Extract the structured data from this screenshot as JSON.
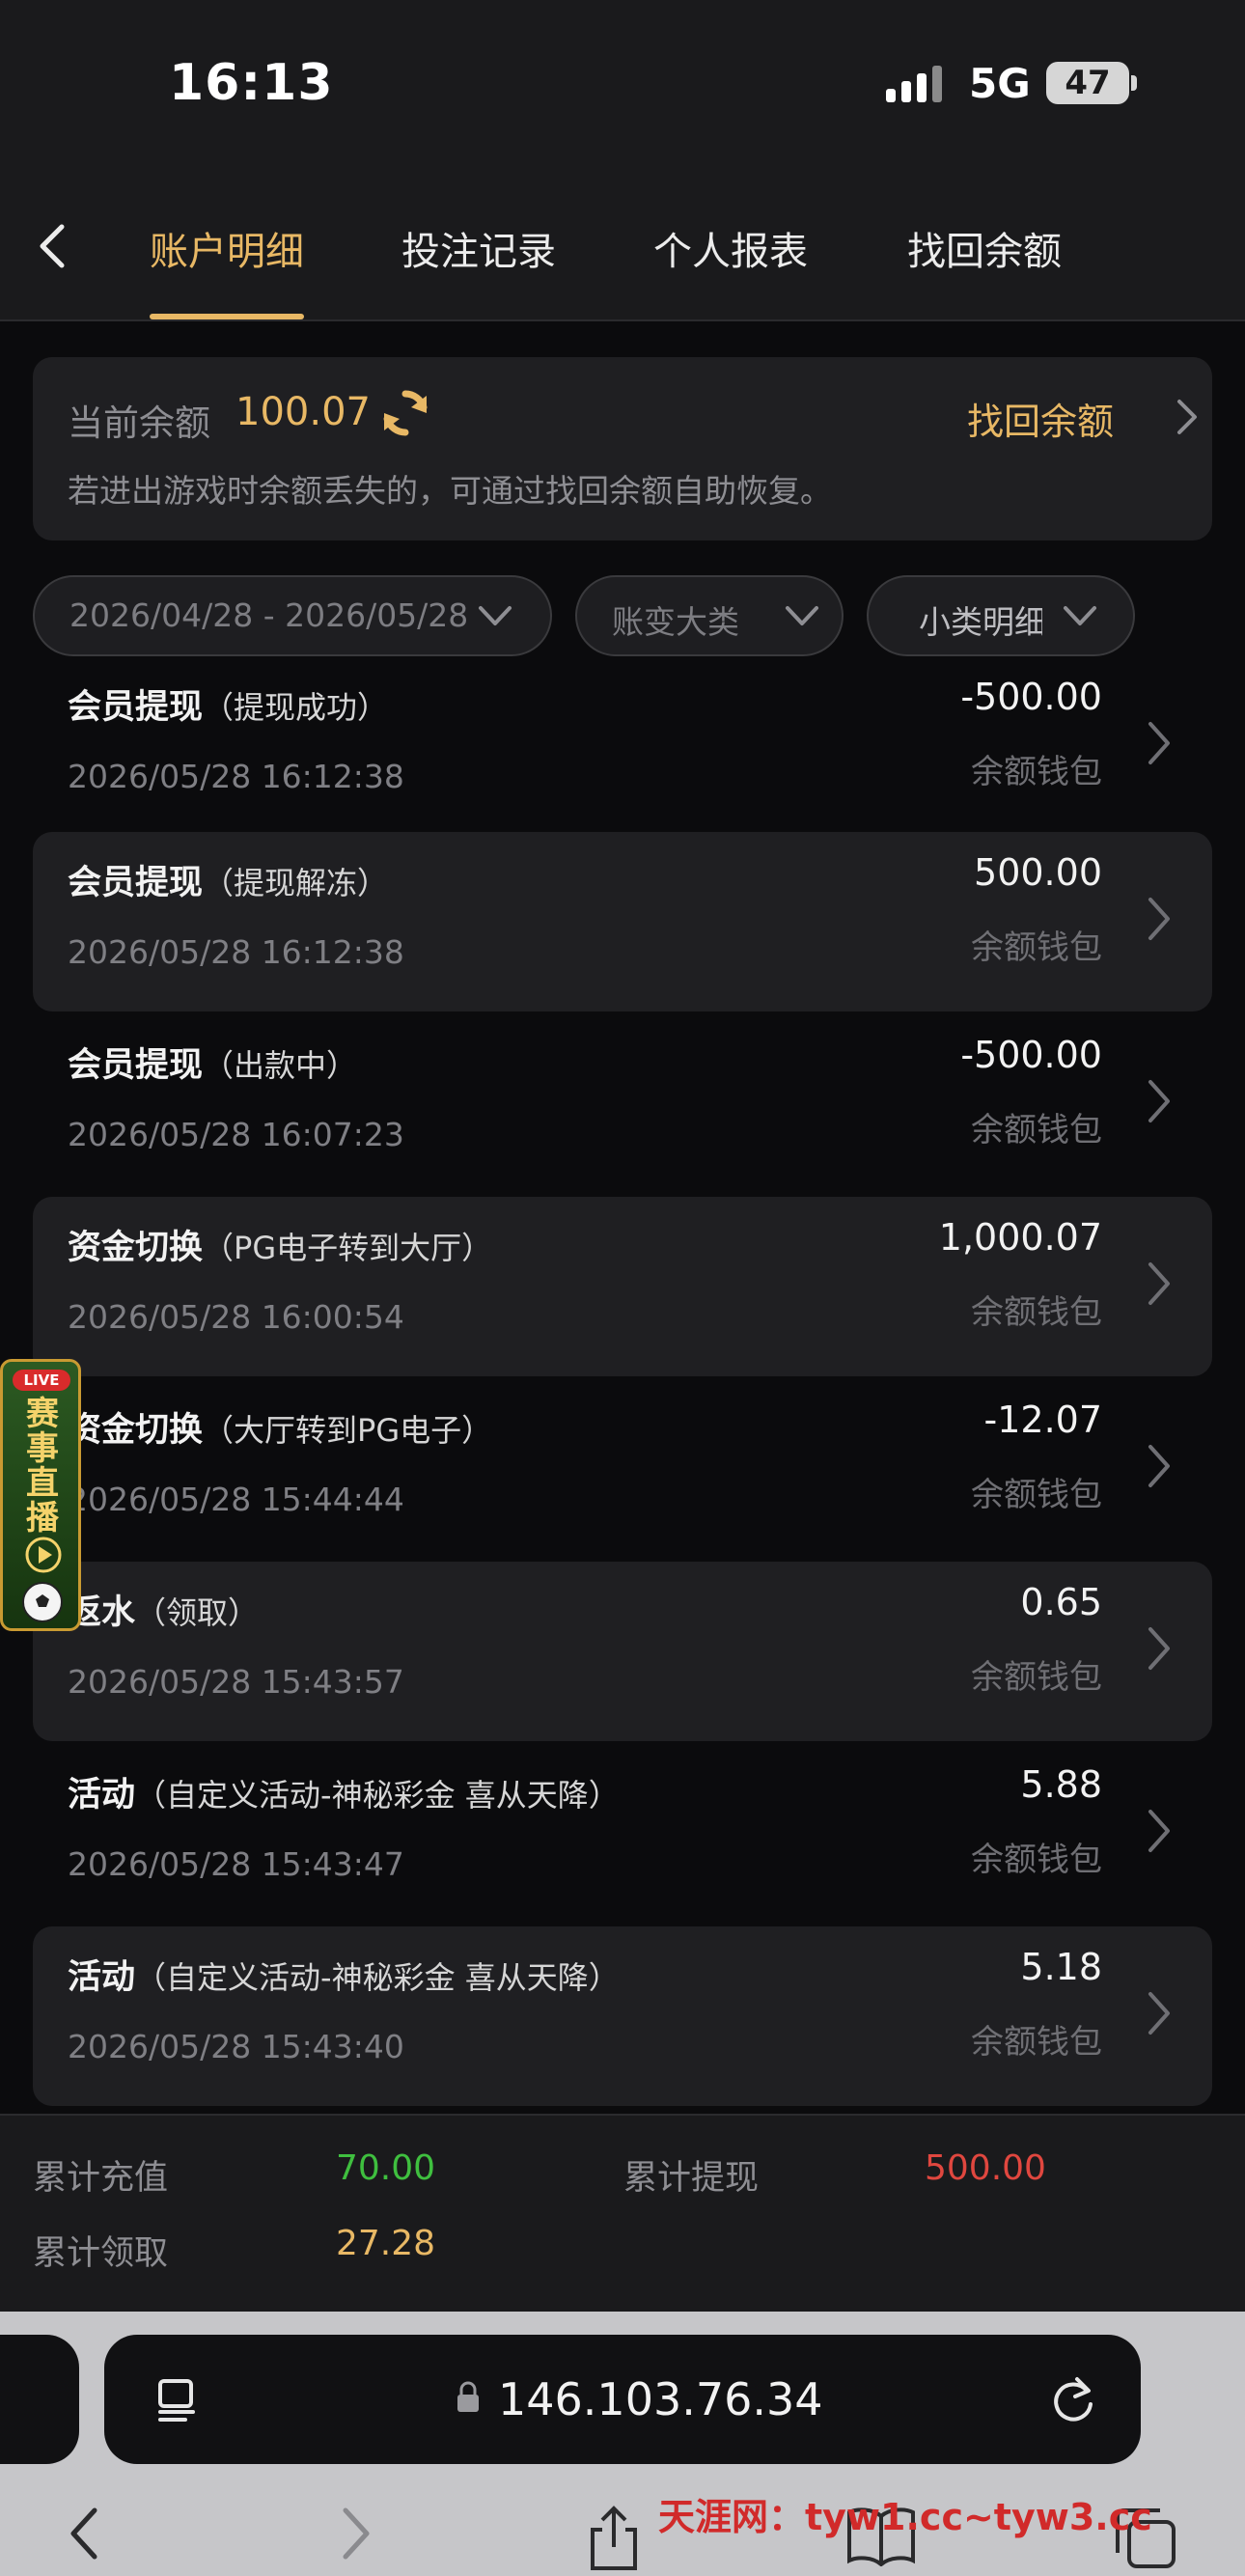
{
  "status": {
    "time": "16:13",
    "network": "5G",
    "battery": "47"
  },
  "tabs": [
    {
      "label": "账户明细",
      "active": true
    },
    {
      "label": "投注记录",
      "active": false
    },
    {
      "label": "个人报表",
      "active": false
    },
    {
      "label": "找回余额",
      "active": false
    }
  ],
  "balance": {
    "label": "当前余额",
    "value": "100.07",
    "recover_label": "找回余额",
    "hint": "若进出游戏时余额丢失的，可通过找回余额自助恢复。"
  },
  "filters": {
    "date_range": "2026/04/28 - 2026/05/28",
    "category": "账变大类",
    "subcategory": "小类明细"
  },
  "records": [
    {
      "title": "会员提现",
      "sub": "（提现成功）",
      "time": "2026/05/28 16:12:38",
      "amount": "-500.00",
      "wallet": "余额钱包"
    },
    {
      "title": "会员提现",
      "sub": "（提现解冻）",
      "time": "2026/05/28 16:12:38",
      "amount": "500.00",
      "wallet": "余额钱包"
    },
    {
      "title": "会员提现",
      "sub": "（出款中）",
      "time": "2026/05/28 16:07:23",
      "amount": "-500.00",
      "wallet": "余额钱包"
    },
    {
      "title": "资金切换",
      "sub": "（PG电子转到大厅）",
      "time": "2026/05/28 16:00:54",
      "amount": "1,000.07",
      "wallet": "余额钱包"
    },
    {
      "title": "资金切换",
      "sub": "（大厅转到PG电子）",
      "time": "2026/05/28 15:44:44",
      "amount": "-12.07",
      "wallet": "余额钱包"
    },
    {
      "title": "返水",
      "sub": "（领取）",
      "time": "2026/05/28 15:43:57",
      "amount": "0.65",
      "wallet": "余额钱包"
    },
    {
      "title": "活动",
      "sub": "（自定义活动-神秘彩金 喜从天降）",
      "time": "2026/05/28 15:43:47",
      "amount": "5.88",
      "wallet": "余额钱包"
    },
    {
      "title": "活动",
      "sub": "（自定义活动-神秘彩金 喜从天降）",
      "time": "2026/05/28 15:43:40",
      "amount": "5.18",
      "wallet": "余额钱包"
    }
  ],
  "live_badge": {
    "tag": "LIVE",
    "text": "赛事直播"
  },
  "summary": {
    "recharge_label": "累计充值",
    "recharge_value": "70.00",
    "withdraw_label": "累计提现",
    "withdraw_value": "500.00",
    "claim_label": "累计领取",
    "claim_value": "27.28"
  },
  "browser": {
    "url": "146.103.76.34"
  },
  "watermark": "天涯网：tyw1.cc~tyw3.cc",
  "colors": {
    "accent": "#e8b865",
    "positive": "#3fbf3f",
    "negative": "#e0473f"
  }
}
